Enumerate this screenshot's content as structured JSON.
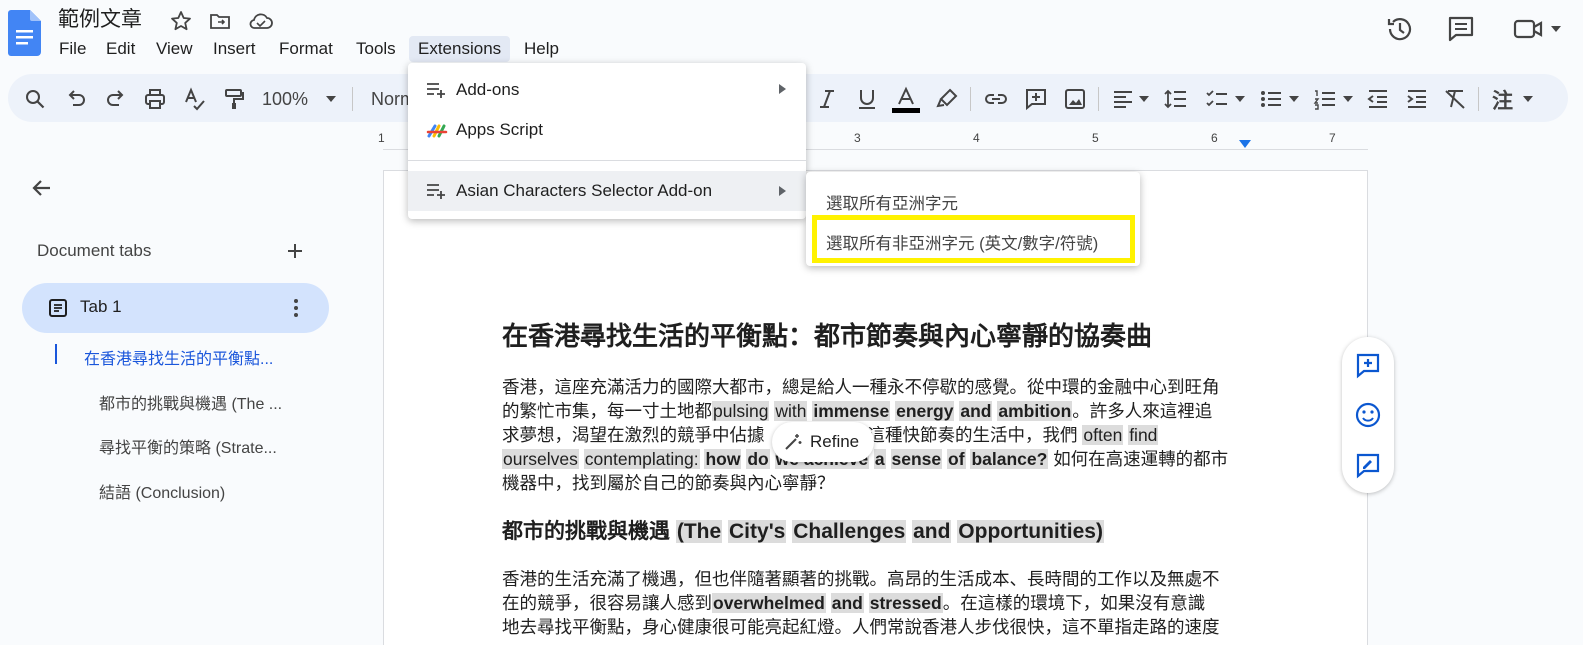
{
  "document": {
    "title": "範例文章"
  },
  "menubar": [
    {
      "key": "file",
      "label": "File"
    },
    {
      "key": "edit",
      "label": "Edit"
    },
    {
      "key": "view",
      "label": "View"
    },
    {
      "key": "insert",
      "label": "Insert"
    },
    {
      "key": "format",
      "label": "Format"
    },
    {
      "key": "tools",
      "label": "Tools"
    },
    {
      "key": "extensions",
      "label": "Extensions",
      "active": true
    },
    {
      "key": "help",
      "label": "Help"
    }
  ],
  "toolbar": {
    "zoom": "100%",
    "style": "Norm",
    "input_tool": "注"
  },
  "ruler": {
    "numbers": [
      "1",
      "3",
      "4",
      "5",
      "6",
      "7"
    ]
  },
  "sidebar": {
    "title": "Document tabs",
    "tab": {
      "label": "Tab 1"
    },
    "outline": [
      {
        "label": "在香港尋找生活的平衡點...",
        "active": true
      },
      {
        "label": "都市的挑戰與機遇 (The ..."
      },
      {
        "label": "尋找平衡的策略 (Strate..."
      },
      {
        "label": "結語 (Conclusion)"
      }
    ]
  },
  "extensions_menu": {
    "items": [
      {
        "label": "Add-ons",
        "icon": "add-ons-icon",
        "has_submenu": true
      },
      {
        "label": "Apps Script",
        "icon": "apps-script-icon",
        "has_submenu": false
      },
      {
        "label": "Asian Characters Selector Add-on",
        "icon": "add-on-icon",
        "has_submenu": true,
        "hovered": true
      }
    ],
    "submenu": [
      {
        "label": "選取所有亞洲字元"
      },
      {
        "label": "選取所有非亞洲字元 (英文/數字/符號)",
        "highlighted": true,
        "highlight_color": "#fff200"
      }
    ]
  },
  "content": {
    "heading1": "在香港尋找生活的平衡點：都市節奏與內心寧靜的協奏曲",
    "p1": {
      "l1": "香港，這座充滿活力的國際大都市，總是給人一種永不停歇的感覺。從中環的金融中心到旺角",
      "l2a": "的繁忙市集，每一寸土地都",
      "l2_pulsing": "pulsing",
      "l2_with": "with",
      "l2_immense": "immense",
      "l2_energy": "energy",
      "l2_and": "and",
      "l2_ambition": "ambition",
      "l2b": "。許多人來這裡追",
      "l3a": "求夢想，渴望在激烈的競爭中佔據",
      "l3b": "然而，在這種快節奏的生活中，我們",
      "l3_often": "often",
      "l3_find": "find",
      "l4_ourselves": "ourselves",
      "l4_contemplating": "contemplating:",
      "l4_how": "how",
      "l4_do": "do",
      "l4_we_achieve": "we achieve",
      "l4_a": "a",
      "l4_sense": "sense",
      "l4_of": "of",
      "l4_balance": "balance?",
      "l4b": "如何在高速運轉的都市",
      "l5": "機器中，找到屬於自己的節奏與內心寧靜？"
    },
    "heading2": {
      "zh": "都市的挑戰與機遇",
      "the": "(The",
      "citys": "City's",
      "challenges": "Challenges",
      "and": "and",
      "opportunities": "Opportunities)"
    },
    "p2": {
      "l1": "香港的生活充滿了機遇，但也伴隨著顯著的挑戰。高昂的生活成本、長時間的工作以及無處不",
      "l2a": "在的競爭，很容易讓人感到",
      "overwhelmed": "overwhelmed",
      "and": "and",
      "stressed": "stressed",
      "l2b": "。在這樣的環境下，如果沒有意識",
      "l3": "地去尋找平衡點，身心健康很可能亮起紅燈。人們常說香港人步伐很快，這不單指走路的速度"
    }
  },
  "refine": {
    "label": "Refine"
  },
  "colors": {
    "accent": "#1a56db",
    "toolbar_bg": "#edf2fa",
    "tab_active": "#d3e3fd",
    "highlight": "#fff200"
  }
}
